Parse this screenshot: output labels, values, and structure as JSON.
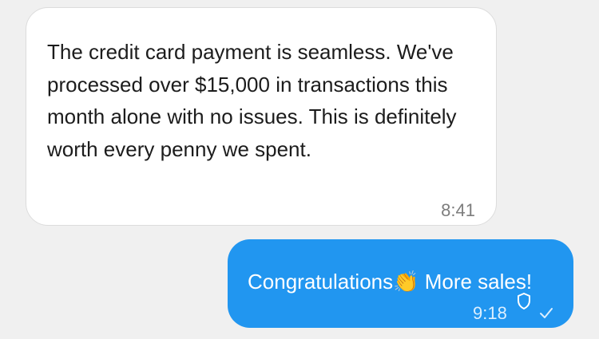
{
  "messages": {
    "incoming": {
      "text": "The credit card payment is seamless. We've processed over $15,000 in transactions this month alone with no issues. This is definitely worth every penny we spent.",
      "time": "8:41"
    },
    "outgoing": {
      "text_before_emoji": "Congratulations",
      "emoji": "👏",
      "text_after_emoji": " More sales!",
      "time": "9:18",
      "status_icons": [
        "shield-icon",
        "check-icon"
      ]
    }
  },
  "colors": {
    "background": "#f0f0f0",
    "incoming_bubble": "#ffffff",
    "outgoing_bubble": "#2196f0",
    "outgoing_text": "#ffffff"
  }
}
